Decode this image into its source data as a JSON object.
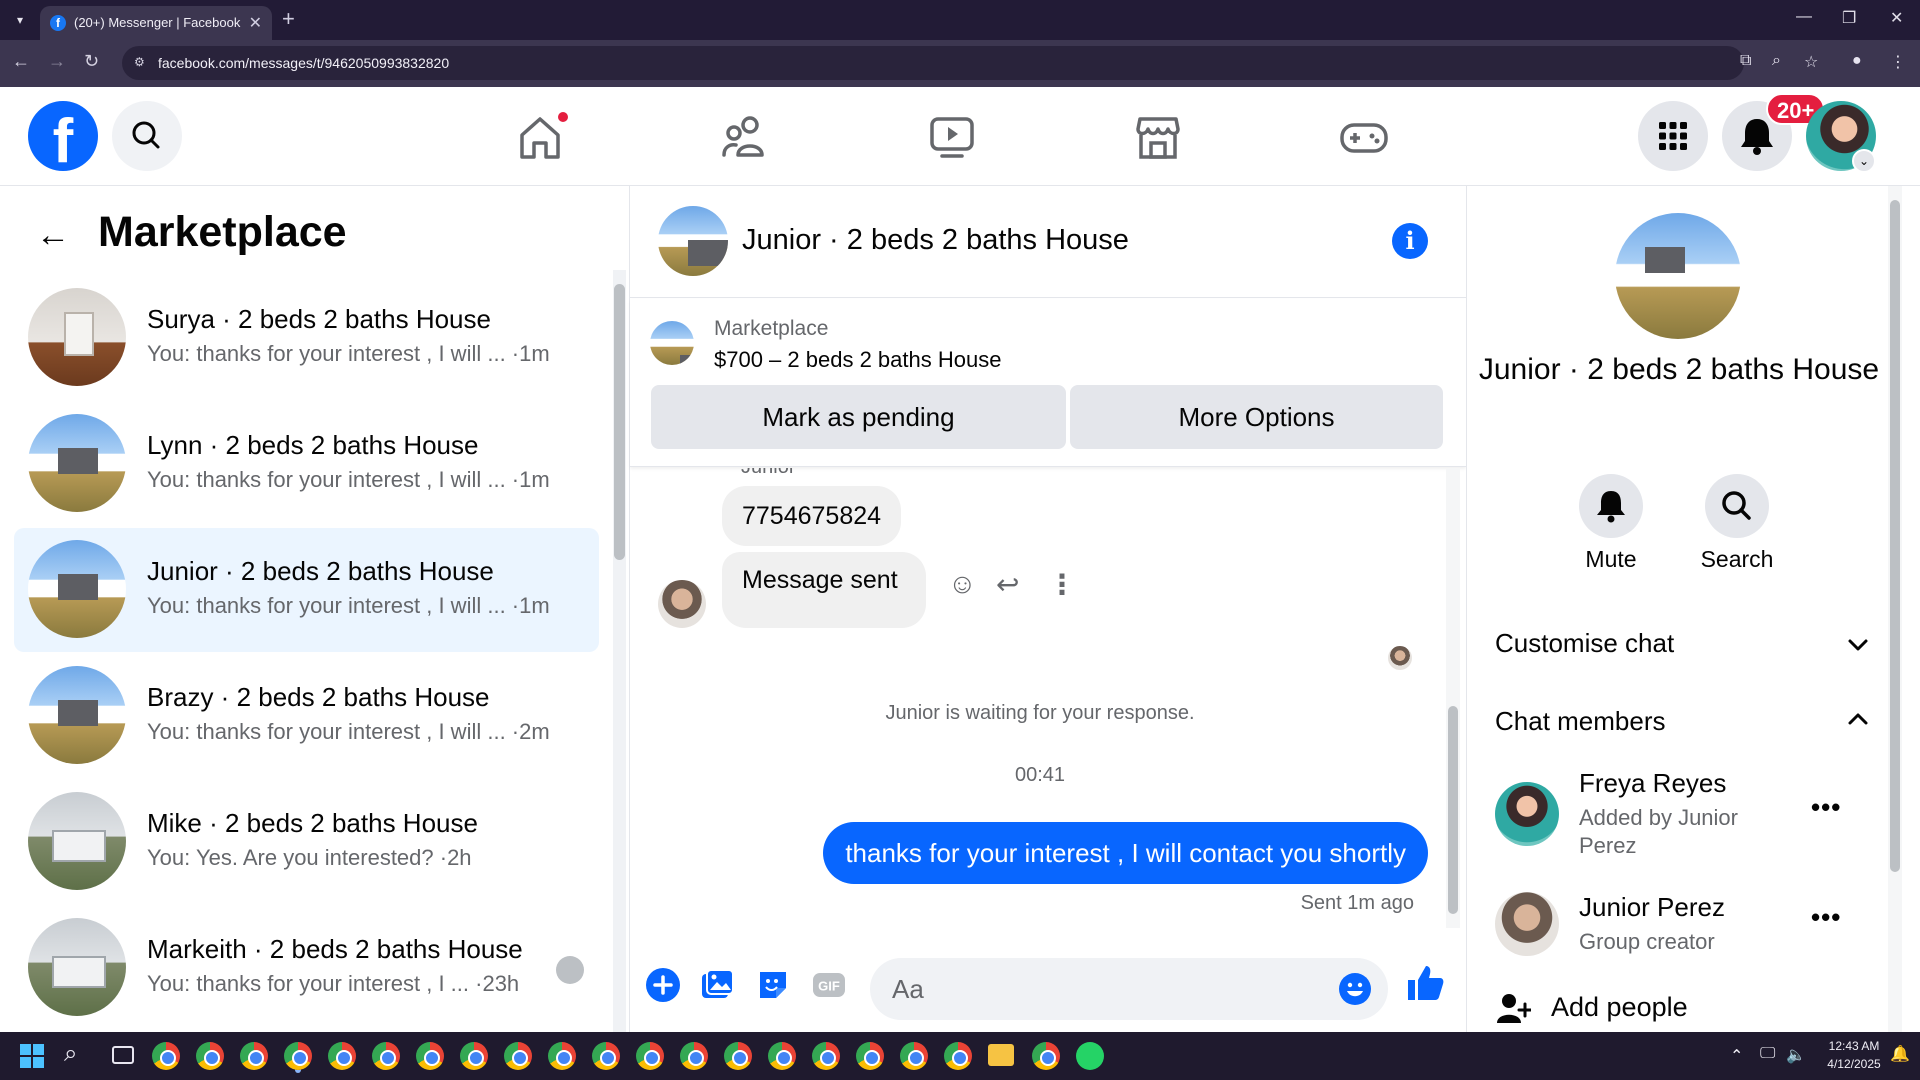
{
  "browser": {
    "tab_title": "(20+) Messenger | Facebook",
    "url": "facebook.com/messages/t/9462050993832820",
    "favicon": "f"
  },
  "fb_header": {
    "logo_letter": "f",
    "notification_count": "20+"
  },
  "left_panel": {
    "title": "Marketplace",
    "conversations": [
      {
        "name": "Surya · 2 beds 2 baths House",
        "preview": "You: thanks for your interest , I will ... ·1m",
        "avatar": "room"
      },
      {
        "name": "Lynn · 2 beds 2 baths House",
        "preview": "You: thanks for your interest , I will ... ·1m",
        "avatar": "house"
      },
      {
        "name": "Junior · 2 beds 2 baths House",
        "preview": "You: thanks for your interest , I will ... ·1m",
        "avatar": "house",
        "active": true
      },
      {
        "name": "Brazy · 2 beds 2 baths House",
        "preview": "You: thanks for your interest , I will ... ·2m",
        "avatar": "house"
      },
      {
        "name": "Mike · 2 beds 2 baths House",
        "preview": "You: Yes. Are you interested? ·2h",
        "avatar": "grayhouse"
      },
      {
        "name": "Markeith · 2 beds 2 baths House",
        "preview": "You: thanks for your interest , I ... ·23h",
        "avatar": "grayhouse"
      }
    ]
  },
  "chat": {
    "title": "Junior · 2 beds 2 baths House",
    "marketplace_label": "Marketplace",
    "listing": "$700 – 2 beds 2 baths House",
    "mark_pending_label": "Mark as pending",
    "more_options_label": "More Options",
    "sender_name": "Junior",
    "incoming_messages": [
      "7754675824",
      "Message sent"
    ],
    "waiting_text": "Junior is waiting for your response.",
    "timestamp": "00:41",
    "outgoing_message": "thanks for your interest , I will contact you shortly",
    "sent_status": "Sent 1m ago",
    "composer_placeholder": "Aa"
  },
  "right_panel": {
    "title": "Junior · 2 beds 2 baths House",
    "mute_label": "Mute",
    "search_label": "Search",
    "customise_label": "Customise chat",
    "members_label": "Chat members",
    "members": [
      {
        "name": "Freya Reyes",
        "sub": "Added by Junior Perez"
      },
      {
        "name": "Junior Perez",
        "sub": "Group creator"
      }
    ],
    "add_people_label": "Add people"
  },
  "taskbar": {
    "time": "12:43 AM",
    "date": "4/12/2025"
  },
  "colors": {
    "fb_blue": "#0866ff",
    "badge_red": "#e41e3f",
    "active_conv": "#ebf5ff"
  }
}
